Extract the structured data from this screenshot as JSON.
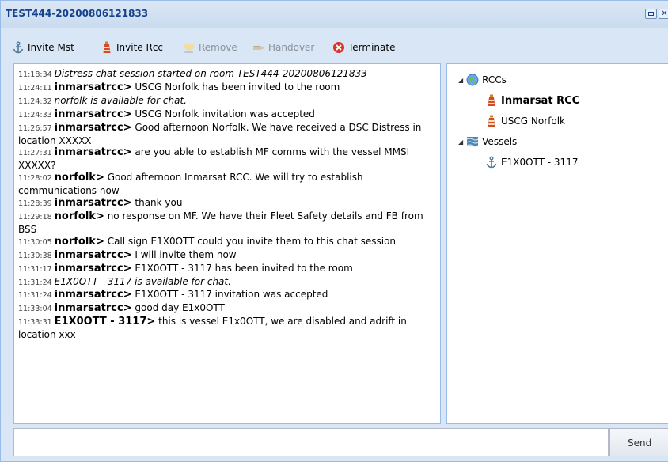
{
  "window": {
    "title": "TEST444-20200806121833"
  },
  "toolbar": {
    "invite_mst": "Invite Mst",
    "invite_rcc": "Invite Rcc",
    "remove": "Remove",
    "handover": "Handover",
    "terminate": "Terminate"
  },
  "chat": {
    "messages": [
      {
        "time": "11:18:34",
        "nick": "",
        "text": "Distress chat session started on room TEST444-20200806121833"
      },
      {
        "time": "11:24:11",
        "nick": "inmarsatrcc>",
        "text": "USCG Norfolk has been invited to the room"
      },
      {
        "time": "11:24:32",
        "nick": "",
        "text": "norfolk is available for chat."
      },
      {
        "time": "11:24:33",
        "nick": "inmarsatrcc>",
        "text": "USCG Norfolk invitation was accepted"
      },
      {
        "time": "11:26:57",
        "nick": "inmarsatrcc>",
        "text": "Good afternoon Norfolk. We have received a DSC Distress in location XXXXX"
      },
      {
        "time": "11:27:31",
        "nick": "inmarsatrcc>",
        "text": "are you able to establish MF comms with the vessel MMSI XXXXX?"
      },
      {
        "time": "11:28:02",
        "nick": "norfolk>",
        "text": "Good afternoon Inmarsat RCC. We will try to establish communications now"
      },
      {
        "time": "11:28:39",
        "nick": "inmarsatrcc>",
        "text": "thank you"
      },
      {
        "time": "11:29:18",
        "nick": "norfolk>",
        "text": "no response on MF. We have their Fleet Safety details and FB from BSS"
      },
      {
        "time": "11:30:05",
        "nick": "norfolk>",
        "text": "Call sign E1X0OTT could you invite them to this chat session"
      },
      {
        "time": "11:30:38",
        "nick": "inmarsatrcc>",
        "text": "I will invite them now"
      },
      {
        "time": "11:31:17",
        "nick": "inmarsatrcc>",
        "text": "E1X0OTT - 3117 has been invited to the room"
      },
      {
        "time": "11:31:24",
        "nick": "",
        "text": "E1X0OTT - 3117 is available for chat."
      },
      {
        "time": "11:31:24",
        "nick": "inmarsatrcc>",
        "text": "E1X0OTT - 3117 invitation was accepted"
      },
      {
        "time": "11:33:04",
        "nick": "inmarsatrcc>",
        "text": "good day E1x0OTT"
      },
      {
        "time": "11:33:31",
        "nick": "E1X0OTT - 3117>",
        "text": "this is vessel E1x0OTT, we are disabled and adrift in location xxx"
      }
    ]
  },
  "tree": {
    "rccs_label": "RCCs",
    "rcc_items": [
      "Inmarsat RCC",
      "USCG Norfolk"
    ],
    "vessels_label": "Vessels",
    "vessel_items": [
      "E1X0OTT - 3117"
    ]
  },
  "input": {
    "value": "",
    "send_label": "Send"
  }
}
